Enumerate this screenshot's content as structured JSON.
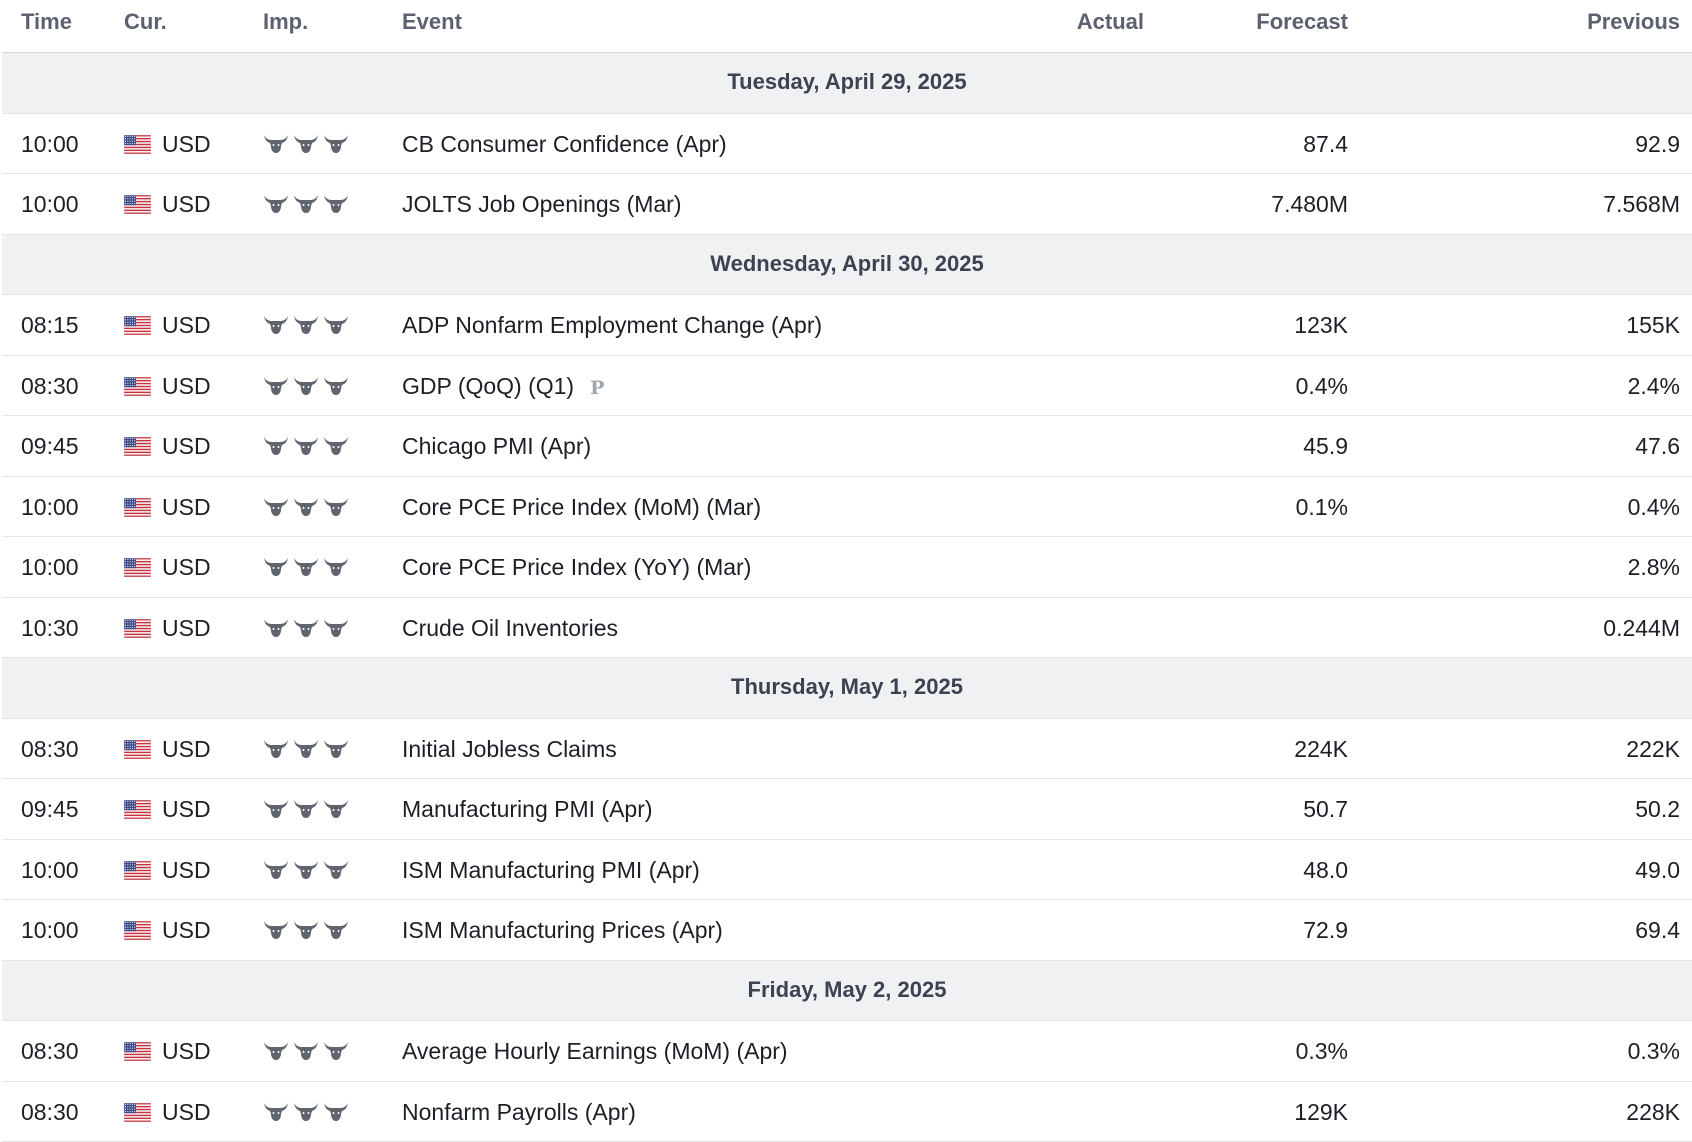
{
  "columns": {
    "time": "Time",
    "currency": "Cur.",
    "importance": "Imp.",
    "event": "Event",
    "actual": "Actual",
    "forecast": "Forecast",
    "previous": "Previous"
  },
  "colors": {
    "header_text": "#5b616e",
    "day_band": "#f0f1f3",
    "bull_icon": "#5f646d",
    "row_border": "#e2e4e8"
  },
  "icons": {
    "flag": "us-flag-icon",
    "importance": "bull-icon",
    "preliminary": "preliminary-icon"
  },
  "days": [
    {
      "label": "Tuesday, April 29, 2025",
      "events": [
        {
          "time": "10:00",
          "currency": "USD",
          "importance": 3,
          "name": "CB Consumer Confidence (Apr)",
          "actual": "",
          "forecast": "87.4",
          "previous": "92.9"
        },
        {
          "time": "10:00",
          "currency": "USD",
          "importance": 3,
          "name": "JOLTS Job Openings (Mar)",
          "actual": "",
          "forecast": "7.480M",
          "previous": "7.568M"
        }
      ]
    },
    {
      "label": "Wednesday, April 30, 2025",
      "events": [
        {
          "time": "08:15",
          "currency": "USD",
          "importance": 3,
          "name": "ADP Nonfarm Employment Change (Apr)",
          "actual": "",
          "forecast": "123K",
          "previous": "155K"
        },
        {
          "time": "08:30",
          "currency": "USD",
          "importance": 3,
          "name": "GDP (QoQ) (Q1)",
          "badge": "P",
          "actual": "",
          "forecast": "0.4%",
          "previous": "2.4%"
        },
        {
          "time": "09:45",
          "currency": "USD",
          "importance": 3,
          "name": "Chicago PMI (Apr)",
          "actual": "",
          "forecast": "45.9",
          "previous": "47.6"
        },
        {
          "time": "10:00",
          "currency": "USD",
          "importance": 3,
          "name": "Core PCE Price Index (MoM) (Mar)",
          "actual": "",
          "forecast": "0.1%",
          "previous": "0.4%"
        },
        {
          "time": "10:00",
          "currency": "USD",
          "importance": 3,
          "name": "Core PCE Price Index (YoY) (Mar)",
          "actual": "",
          "forecast": "",
          "previous": "2.8%"
        },
        {
          "time": "10:30",
          "currency": "USD",
          "importance": 3,
          "name": "Crude Oil Inventories",
          "actual": "",
          "forecast": "",
          "previous": "0.244M"
        }
      ]
    },
    {
      "label": "Thursday, May 1, 2025",
      "events": [
        {
          "time": "08:30",
          "currency": "USD",
          "importance": 3,
          "name": "Initial Jobless Claims",
          "actual": "",
          "forecast": "224K",
          "previous": "222K"
        },
        {
          "time": "09:45",
          "currency": "USD",
          "importance": 3,
          "name": "Manufacturing PMI (Apr)",
          "actual": "",
          "forecast": "50.7",
          "previous": "50.2"
        },
        {
          "time": "10:00",
          "currency": "USD",
          "importance": 3,
          "name": "ISM Manufacturing PMI (Apr)",
          "actual": "",
          "forecast": "48.0",
          "previous": "49.0"
        },
        {
          "time": "10:00",
          "currency": "USD",
          "importance": 3,
          "name": "ISM Manufacturing Prices (Apr)",
          "actual": "",
          "forecast": "72.9",
          "previous": "69.4"
        }
      ]
    },
    {
      "label": "Friday, May 2, 2025",
      "events": [
        {
          "time": "08:30",
          "currency": "USD",
          "importance": 3,
          "name": "Average Hourly Earnings (MoM) (Apr)",
          "actual": "",
          "forecast": "0.3%",
          "previous": "0.3%"
        },
        {
          "time": "08:30",
          "currency": "USD",
          "importance": 3,
          "name": "Nonfarm Payrolls (Apr)",
          "actual": "",
          "forecast": "129K",
          "previous": "228K"
        }
      ]
    }
  ]
}
